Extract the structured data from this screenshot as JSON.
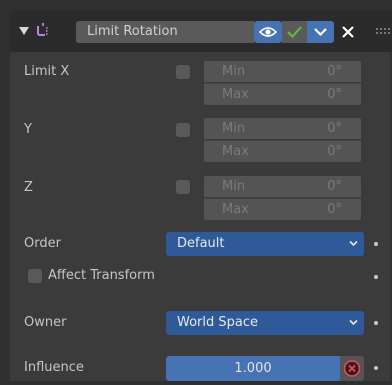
{
  "header": {
    "constraint_name": "Limit Rotation",
    "icons": [
      "collapse-arrow-icon",
      "constraint-limit-rotation-icon",
      "eye-icon",
      "checkmark-icon",
      "chevron-down-icon",
      "close-icon",
      "drag-grip-icon"
    ]
  },
  "axes": [
    {
      "label": "Limit X",
      "min_label": "Min",
      "min_value": "0°",
      "max_label": "Max",
      "max_value": "0°",
      "checked": false
    },
    {
      "label": "Y",
      "min_label": "Min",
      "min_value": "0°",
      "max_label": "Max",
      "max_value": "0°",
      "checked": false
    },
    {
      "label": "Z",
      "min_label": "Min",
      "min_value": "0°",
      "max_label": "Max",
      "max_value": "0°",
      "checked": false
    }
  ],
  "order": {
    "label": "Order",
    "value": "Default"
  },
  "affect_transform": {
    "label": "Affect Transform",
    "checked": false
  },
  "owner": {
    "label": "Owner",
    "value": "World Space"
  },
  "influence": {
    "label": "Influence",
    "value": "1.000"
  },
  "colors": {
    "accent": "#4772b3",
    "dropdown": "#2f5a9a",
    "panel": "#3b3b3b",
    "header": "#2b2b2b",
    "check_green": "#5fbf3c",
    "clear_red": "#e24d55"
  }
}
